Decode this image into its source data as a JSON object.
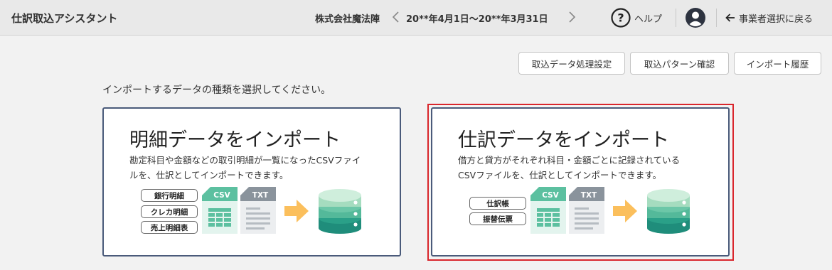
{
  "header": {
    "app_title": "仕訳取込アシスタント",
    "company": "株式会社魔法陣",
    "period": "20**年4月1日〜20**年3月31日",
    "help_label": "ヘルプ",
    "back_label": "事業者選択に戻る"
  },
  "toolbar": {
    "settings_label": "取込データ処理設定",
    "pattern_label": "取込パターン確認",
    "history_label": "インポート履歴"
  },
  "instruction": "インポートするデータの種類を選択してください。",
  "cards": [
    {
      "title": "明細データをインポート",
      "desc_line1": "勘定科目や金額などの取引明細が一覧になったCSVファイ",
      "desc_line2": "ルを、仕訳としてインポートできます。",
      "tags": [
        "銀行明細",
        "クレカ明細",
        "売上明細表"
      ],
      "csv_label": "CSV",
      "txt_label": "TXT"
    },
    {
      "title": "仕訳データをインポート",
      "desc_line1": "借方と貸方がそれぞれ科目・金額ごとに記録されている",
      "desc_line2": "CSVファイルを、仕訳としてインポートできます。",
      "tags": [
        "仕訳帳",
        "振替伝票"
      ],
      "csv_label": "CSV",
      "txt_label": "TXT",
      "highlighted": true
    }
  ],
  "colors": {
    "card_border": "#4a5a7a",
    "highlight": "#d9262c",
    "csv_green": "#5cc0a0",
    "txt_gray": "#8a939c",
    "arrow": "#fbbf5c",
    "db_top": "#bfe6cf",
    "db_mid": "#54b99a",
    "db_bottom": "#1f8d7b"
  },
  "icons": [
    "chevron-left-icon",
    "chevron-right-icon",
    "help-circle-icon",
    "user-avatar-icon",
    "arrow-left-icon",
    "csv-file-icon",
    "txt-file-icon",
    "arrow-right-icon",
    "database-icon"
  ]
}
